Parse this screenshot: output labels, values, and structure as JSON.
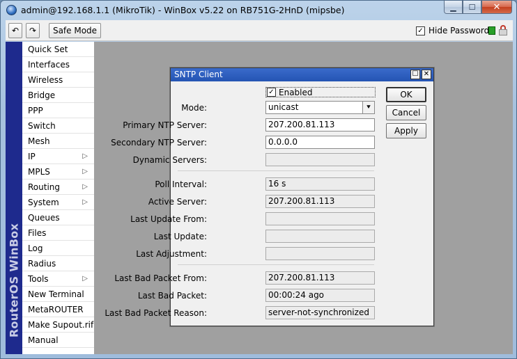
{
  "window": {
    "title": "admin@192.168.1.1 (MikroTik) - WinBox v5.22 on RB751G-2HnD (mipsbe)",
    "minimize": "▁",
    "maximize": "☐",
    "close": "✕"
  },
  "toolbar": {
    "undo": "↶",
    "redo": "↷",
    "safe_mode": "Safe Mode",
    "hide_passwords_label": "Hide Passwords",
    "hide_passwords_checked": "✓"
  },
  "brand": "RouterOS WinBox",
  "sidebar": {
    "items": [
      {
        "label": "Quick Set",
        "arrow": ""
      },
      {
        "label": "Interfaces",
        "arrow": ""
      },
      {
        "label": "Wireless",
        "arrow": ""
      },
      {
        "label": "Bridge",
        "arrow": ""
      },
      {
        "label": "PPP",
        "arrow": ""
      },
      {
        "label": "Switch",
        "arrow": ""
      },
      {
        "label": "Mesh",
        "arrow": ""
      },
      {
        "label": "IP",
        "arrow": "▷"
      },
      {
        "label": "MPLS",
        "arrow": "▷"
      },
      {
        "label": "Routing",
        "arrow": "▷"
      },
      {
        "label": "System",
        "arrow": "▷"
      },
      {
        "label": "Queues",
        "arrow": ""
      },
      {
        "label": "Files",
        "arrow": ""
      },
      {
        "label": "Log",
        "arrow": ""
      },
      {
        "label": "Radius",
        "arrow": ""
      },
      {
        "label": "Tools",
        "arrow": "▷"
      },
      {
        "label": "New Terminal",
        "arrow": ""
      },
      {
        "label": "MetaROUTER",
        "arrow": ""
      },
      {
        "label": "Make Supout.rif",
        "arrow": ""
      },
      {
        "label": "Manual",
        "arrow": ""
      }
    ]
  },
  "dialog": {
    "title": "SNTP Client",
    "max_btn": "☐",
    "close_btn": "✕",
    "enabled_label": "Enabled",
    "enabled_mark": "✓",
    "buttons": {
      "ok": "OK",
      "cancel": "Cancel",
      "apply": "Apply"
    },
    "fields": {
      "mode": {
        "label": "Mode:",
        "value": "unicast",
        "arrow": "⯆"
      },
      "primary": {
        "label": "Primary NTP Server:",
        "value": "207.200.81.113"
      },
      "secondary": {
        "label": "Secondary NTP Server:",
        "value": "0.0.0.0"
      },
      "dynamic": {
        "label": "Dynamic Servers:",
        "value": ""
      },
      "poll": {
        "label": "Poll Interval:",
        "value": "16 s"
      },
      "active": {
        "label": "Active Server:",
        "value": "207.200.81.113"
      },
      "last_update_from": {
        "label": "Last Update From:",
        "value": ""
      },
      "last_update": {
        "label": "Last Update:",
        "value": ""
      },
      "last_adjustment": {
        "label": "Last Adjustment:",
        "value": ""
      },
      "bad_from": {
        "label": "Last Bad Packet From:",
        "value": "207.200.81.113"
      },
      "bad_packet": {
        "label": "Last Bad Packet:",
        "value": "00:00:24 ago"
      },
      "bad_reason": {
        "label": "Last Bad Packet Reason:",
        "value": "server-not-synchronized"
      }
    }
  }
}
